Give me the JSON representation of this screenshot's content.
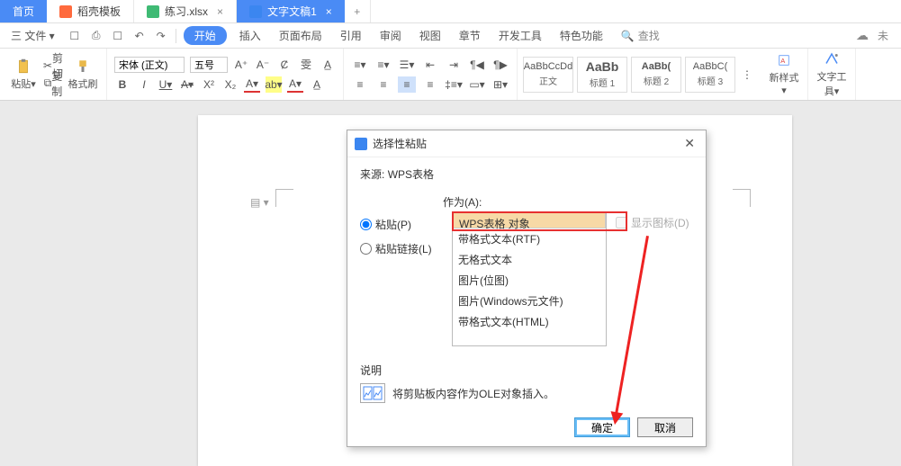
{
  "tabs": {
    "home": "首页",
    "template": "稻壳模板",
    "xlsx": "练习.xlsx",
    "doc": "文字文稿1"
  },
  "menu": {
    "file": "三 文件 ▾",
    "start": "开始",
    "items": [
      "插入",
      "页面布局",
      "引用",
      "审阅",
      "视图",
      "章节",
      "开发工具",
      "特色功能"
    ],
    "search": "查找",
    "undisplayed": "未"
  },
  "ribbon": {
    "paste": "粘贴▾",
    "cut": "剪切",
    "copy": "复制",
    "brush": "格式刷",
    "font_name": "宋体 (正文)",
    "font_size": "五号",
    "styles": [
      {
        "prev": "AaBbCcDd",
        "cap": "正文"
      },
      {
        "prev": "AaBb",
        "cap": "标题 1"
      },
      {
        "prev": "AaBb(",
        "cap": "标题 2"
      },
      {
        "prev": "AaBbC(",
        "cap": "标题 3"
      }
    ],
    "newstyle": "新样式▾",
    "texttool": "文字工具▾"
  },
  "dialog": {
    "title": "选择性粘贴",
    "source_label": "来源:",
    "source_value": "WPS表格",
    "as_label": "作为(A):",
    "radio_paste": "粘贴(P)",
    "radio_link": "粘贴链接(L)",
    "options": [
      "WPS表格 对象",
      "带格式文本(RTF)",
      "无格式文本",
      "图片(位图)",
      "图片(Windows元文件)",
      "带格式文本(HTML)"
    ],
    "show_icon": "显示图标(D)",
    "explain_hd": "说明",
    "explain_txt": "将剪贴板内容作为OLE对象插入。",
    "ok": "确定",
    "cancel": "取消"
  }
}
